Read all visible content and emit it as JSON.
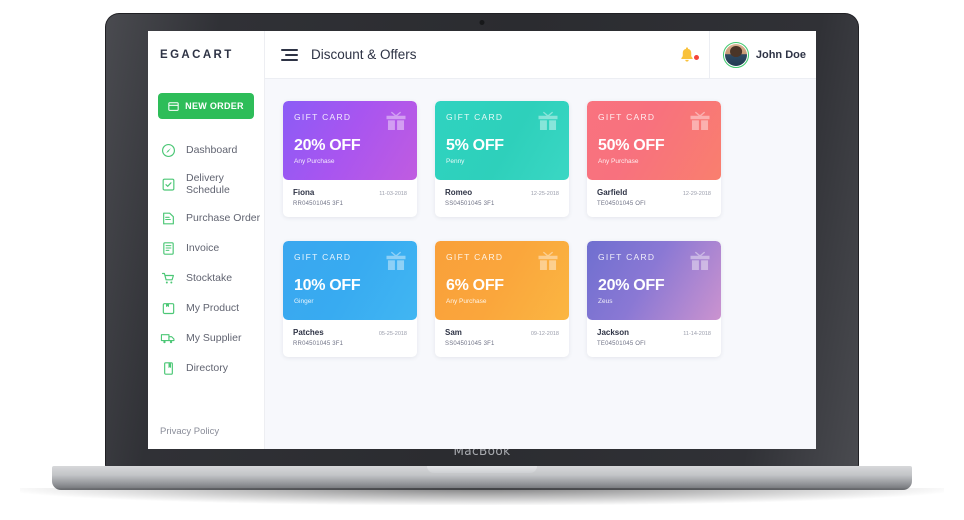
{
  "device": {
    "wordmark": "MacBook"
  },
  "header": {
    "brand": "EGACART",
    "menu_icon": "hamburger-icon",
    "title": "Discount & Offers",
    "bell_icon": "bell-icon",
    "user_name": "John Doe"
  },
  "sidebar": {
    "new_order_label": "NEW ORDER",
    "items": [
      {
        "label": "Dashboard",
        "icon": "dashboard-icon"
      },
      {
        "label": "Delivery Schedule",
        "icon": "clipboard-check-icon"
      },
      {
        "label": "Purchase Order",
        "icon": "purchase-order-icon"
      },
      {
        "label": "Invoice",
        "icon": "invoice-icon"
      },
      {
        "label": "Stocktake",
        "icon": "cart-icon"
      },
      {
        "label": "My Product",
        "icon": "box-icon"
      },
      {
        "label": "My Supplier",
        "icon": "truck-icon"
      },
      {
        "label": "Directory",
        "icon": "book-icon"
      }
    ],
    "privacy_policy": "Privacy Policy"
  },
  "colors": {
    "accent_green": "#2ebd59",
    "notification_red": "#f4453c",
    "text_dark": "#2e3345",
    "canvas": "#f7f8fc"
  },
  "main": {
    "card_label": "GIFT CARD",
    "cards": [
      {
        "label": "GIFT CARD",
        "discount": "20% OFF",
        "sub": "Any Purchase",
        "person": "Fiona",
        "date": "11-03-2018",
        "code": "RR04501045 3F1",
        "gradient": "linear-gradient(120deg,#8b5cf6 0%,#a855f0 48%,#c05ce0 100%)"
      },
      {
        "label": "GIFT CARD",
        "discount": "5% OFF",
        "sub": "Penny",
        "person": "Romeo",
        "date": "12-25-2018",
        "code": "SS04501045 3F1",
        "gradient": "linear-gradient(120deg,#2fd3c0 0%,#2ed0bb 55%,#3ad7c4 100%)"
      },
      {
        "label": "GIFT CARD",
        "discount": "50% OFF",
        "sub": "Any Purchase",
        "person": "Garfield",
        "date": "12-29-2018",
        "code": "TE04501045 OFI",
        "gradient": "linear-gradient(120deg,#f9737f 0%,#f8717e 40%,#f97f6e 100%)"
      },
      {
        "label": "GIFT CARD",
        "discount": "10% OFF",
        "sub": "Ginger",
        "person": "Patches",
        "date": "05-25-2018",
        "code": "RR04501045 3F1",
        "gradient": "linear-gradient(120deg,#3aa7ef 0%,#38abf1 50%,#41b6f2 100%)"
      },
      {
        "label": "GIFT CARD",
        "discount": "6% OFF",
        "sub": "Any Purchase",
        "person": "Sam",
        "date": "09-12-2018",
        "code": "SS04501045 3F1",
        "gradient": "linear-gradient(120deg,#f9a03a 0%,#faa63c 50%,#fbb642 100%)"
      },
      {
        "label": "GIFT CARD",
        "discount": "20% OFF",
        "sub": "Zeus",
        "person": "Jackson",
        "date": "11-14-2018",
        "code": "TE04501045 OFI",
        "gradient": "linear-gradient(120deg,#6f6fd0 0%,#8a78d4 45%,#cb93cf 100%)"
      }
    ]
  }
}
